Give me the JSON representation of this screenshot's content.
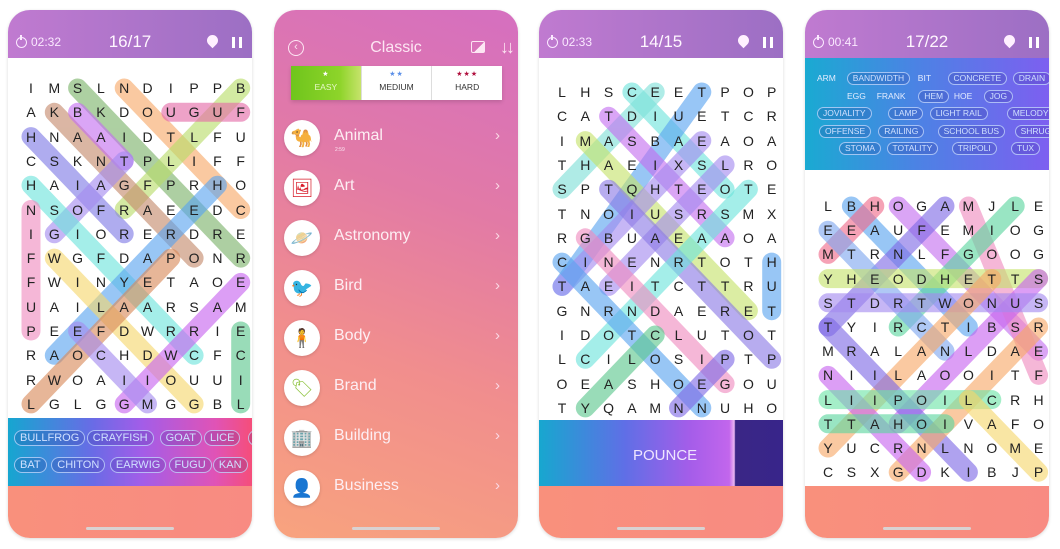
{
  "screens": [
    {
      "type": "puzzle",
      "timer": "02:32",
      "progress": "16/17",
      "grid": [
        "IMSLNDIPPB",
        "AKBKDOUGUF",
        "HNAAIDTLFU",
        "CSKNTPLIFF",
        "HAIAGFPRHO",
        "NSOFRAEEDC",
        "IGIORERDRE",
        "FWGFDAPONR",
        "FWINYETAOE",
        "UAILAARSAM",
        "PEEFDWRRIE",
        "RAOCHDWCFC",
        "RWOAIIOUUI",
        "LGLGGMGGBL"
      ],
      "highlights": [
        {
          "from": [
            0,
            2
          ],
          "to": [
            7,
            9
          ],
          "color": "#7bb36a"
        },
        {
          "from": [
            0,
            4
          ],
          "to": [
            5,
            9
          ],
          "color": "#f7a968"
        },
        {
          "from": [
            0,
            9
          ],
          "to": [
            5,
            4
          ],
          "color": "#b9dd6a"
        },
        {
          "from": [
            1,
            6
          ],
          "to": [
            1,
            9
          ],
          "color": "#e56aa8"
        },
        {
          "from": [
            1,
            1
          ],
          "to": [
            7,
            7
          ],
          "color": "#c58a6c"
        },
        {
          "from": [
            1,
            2
          ],
          "to": [
            3,
            4
          ],
          "color": "#c46ff0"
        },
        {
          "from": [
            2,
            0
          ],
          "to": [
            6,
            4
          ],
          "color": "#7f7ae6"
        },
        {
          "from": [
            3,
            4
          ],
          "to": [
            6,
            1
          ],
          "color": "#a48bf0"
        },
        {
          "from": [
            4,
            0
          ],
          "to": [
            11,
            7
          ],
          "color": "#6ee4dc"
        },
        {
          "from": [
            4,
            8
          ],
          "to": [
            11,
            1
          ],
          "color": "#5aa4f0"
        },
        {
          "from": [
            5,
            0
          ],
          "to": [
            10,
            0
          ],
          "color": "#f08cc0"
        },
        {
          "from": [
            7,
            1
          ],
          "to": [
            13,
            7
          ],
          "color": "#f6d86e"
        },
        {
          "from": [
            7,
            6
          ],
          "to": [
            13,
            0
          ],
          "color": "#d98a5a"
        },
        {
          "from": [
            8,
            9
          ],
          "to": [
            13,
            4
          ],
          "color": "#c864f0"
        },
        {
          "from": [
            10,
            2
          ],
          "to": [
            13,
            5
          ],
          "color": "#a48bf0"
        },
        {
          "from": [
            10,
            9
          ],
          "to": [
            13,
            9
          ],
          "color": "#5cc88e"
        }
      ],
      "words": [
        [
          "BULLFROG",
          "CRAYFISH",
          "GOAT",
          "LICE",
          "O"
        ],
        [
          "BAT",
          "CHITON",
          "EARWIG",
          "FUGU",
          "KAN"
        ]
      ]
    },
    {
      "type": "menu",
      "title": "Classic",
      "difficulties": [
        {
          "stars": "★",
          "label": "EASY",
          "star_color": "#ffffff",
          "active": true
        },
        {
          "stars": "★★",
          "label": "MEDIUM",
          "star_color": "#5b8fe8",
          "active": false
        },
        {
          "stars": "★★★",
          "label": "HARD",
          "star_color": "#b0103e",
          "active": false
        }
      ],
      "categories": [
        {
          "name": "Animal",
          "sub": "2:59",
          "icon": "camel-icon",
          "glyph": "🐪",
          "color": "#e0167d"
        },
        {
          "name": "Art",
          "sub": "",
          "icon": "portrait-icon",
          "glyph": "🖼",
          "color": "#d81b2a"
        },
        {
          "name": "Astronomy",
          "sub": "",
          "icon": "planet-icon",
          "glyph": "🪐",
          "color": "#b0461c"
        },
        {
          "name": "Bird",
          "sub": "",
          "icon": "bird-icon",
          "glyph": "🐦",
          "color": "#f08a1c"
        },
        {
          "name": "Body",
          "sub": "",
          "icon": "body-icon",
          "glyph": "🧍",
          "color": "#f0c01c"
        },
        {
          "name": "Brand",
          "sub": "",
          "icon": "tag-icon",
          "glyph": "🏷",
          "color": "#8cc23c"
        },
        {
          "name": "Building",
          "sub": "",
          "icon": "building-icon",
          "glyph": "🏢",
          "color": "#8cc23c"
        },
        {
          "name": "Business",
          "sub": "",
          "icon": "businessman-icon",
          "glyph": "👤",
          "color": "#1e7a1e"
        }
      ],
      "chevron": "›"
    },
    {
      "type": "puzzle",
      "timer": "02:33",
      "progress": "14/15",
      "grid": [
        "LHSCEETPOP",
        "CATDIUETCR",
        "IMASBAEAOA",
        "THAEIXSLRO",
        "SPTQHTEOTE",
        "TNOIUSRSMX",
        "RGBUAEAAOA",
        "CINENRTOTH",
        "TAEITCTTRU",
        "GNRNDAERET",
        "IDOTCLUTOT",
        "LCILOSIPTP",
        "OEASHOEGOU",
        "TYQAMNNUHO"
      ],
      "highlights": [
        {
          "from": [
            0,
            3
          ],
          "to": [
            4,
            7
          ],
          "color": "#6ee4dc"
        },
        {
          "from": [
            0,
            4
          ],
          "to": [
            4,
            0
          ],
          "color": "#7fe0d8"
        },
        {
          "from": [
            0,
            6
          ],
          "to": [
            8,
            0
          ],
          "color": "#5aa4f0"
        },
        {
          "from": [
            1,
            2
          ],
          "to": [
            6,
            7
          ],
          "color": "#c46ff0"
        },
        {
          "from": [
            2,
            1
          ],
          "to": [
            9,
            8
          ],
          "color": "#c6e36b"
        },
        {
          "from": [
            2,
            6
          ],
          "to": [
            8,
            0
          ],
          "color": "#a48bf0"
        },
        {
          "from": [
            3,
            7
          ],
          "to": [
            8,
            2
          ],
          "color": "#a48bf0"
        },
        {
          "from": [
            4,
            2
          ],
          "to": [
            11,
            9
          ],
          "color": "#8c7ae6"
        },
        {
          "from": [
            4,
            8
          ],
          "to": [
            11,
            1
          ],
          "color": "#6ee4dc"
        },
        {
          "from": [
            6,
            1
          ],
          "to": [
            12,
            7
          ],
          "color": "#f08cc0"
        },
        {
          "from": [
            7,
            0
          ],
          "to": [
            13,
            6
          ],
          "color": "#5aa4f0"
        },
        {
          "from": [
            7,
            9
          ],
          "to": [
            9,
            9
          ],
          "color": "#5aa4f0"
        },
        {
          "from": [
            10,
            4
          ],
          "to": [
            13,
            1
          ],
          "color": "#5cc88e"
        },
        {
          "from": [
            11,
            7
          ],
          "to": [
            13,
            5
          ],
          "color": "#7f6ae6"
        }
      ],
      "ad_label": "POUNCE"
    },
    {
      "type": "puzzle",
      "timer": "00:41",
      "progress": "17/22",
      "word_rows": [
        [
          {
            "w": "ARM",
            "found": false
          },
          {
            "w": "BANDWIDTH",
            "found": true
          },
          {
            "w": "BIT",
            "found": false
          },
          {
            "w": "CONCRETE",
            "found": true
          },
          {
            "w": "DRAIN",
            "found": true
          }
        ],
        [
          {
            "w": "EGG",
            "found": false
          },
          {
            "w": "FRANK",
            "found": false
          },
          {
            "w": "HEM",
            "found": true
          },
          {
            "w": "HOE",
            "found": false
          },
          {
            "w": "JOG",
            "found": true
          }
        ],
        [
          {
            "w": "JOVIALITY",
            "found": true
          },
          {
            "w": "LAMP",
            "found": true
          },
          {
            "w": "LIGHT RAIL",
            "found": true
          },
          {
            "w": "MELODY",
            "found": true
          }
        ],
        [
          {
            "w": "OFFENSE",
            "found": true
          },
          {
            "w": "RAILING",
            "found": true
          },
          {
            "w": "SCHOOL BUS",
            "found": true
          },
          {
            "w": "SHRUG",
            "found": true
          }
        ],
        [
          {
            "w": "STOMA",
            "found": true
          },
          {
            "w": "TOTALITY",
            "found": true
          },
          {
            "w": "TRIPOLI",
            "found": true
          },
          {
            "w": "TUX",
            "found": true
          }
        ]
      ],
      "grid": [
        "LBHOGAMJLE",
        "EEAUFEMIOG",
        "MTRNLFGOOG",
        "YHEODHETTS",
        "STDRTWONUS",
        "TYIRCTIBSR",
        "MRALANLDAE",
        "NIILAOOITF",
        "LIIPOILCRH",
        "TTAHOIVAFO",
        "YUCRNLNOME",
        "CSXGDKIBJP"
      ],
      "highlights": [
        {
          "from": [
            0,
            1
          ],
          "to": [
            5,
            6
          ],
          "color": "#5aa4f0"
        },
        {
          "from": [
            0,
            2
          ],
          "to": [
            2,
            0
          ],
          "color": "#f06a8a"
        },
        {
          "from": [
            0,
            3
          ],
          "to": [
            6,
            9
          ],
          "color": "#c46ff0"
        },
        {
          "from": [
            0,
            5
          ],
          "to": [
            5,
            0
          ],
          "color": "#7f6ae6"
        },
        {
          "from": [
            0,
            6
          ],
          "to": [
            7,
            9
          ],
          "color": "#f08cc0"
        },
        {
          "from": [
            0,
            8
          ],
          "to": [
            5,
            3
          ],
          "color": "#5cd6a0"
        },
        {
          "from": [
            1,
            0
          ],
          "to": [
            6,
            5
          ],
          "color": "#7fa8f0"
        },
        {
          "from": [
            3,
            0
          ],
          "to": [
            3,
            9
          ],
          "color": "#c6e36b"
        },
        {
          "from": [
            3,
            9
          ],
          "to": [
            9,
            3
          ],
          "color": "#c864f0"
        },
        {
          "from": [
            4,
            0
          ],
          "to": [
            4,
            9
          ],
          "color": "#a48bf0"
        },
        {
          "from": [
            3,
            7
          ],
          "to": [
            10,
            0
          ],
          "color": "#f7a968"
        },
        {
          "from": [
            5,
            0
          ],
          "to": [
            11,
            6
          ],
          "color": "#7f6ae6"
        },
        {
          "from": [
            5,
            9
          ],
          "to": [
            11,
            3
          ],
          "color": "#f7a968"
        },
        {
          "from": [
            7,
            0
          ],
          "to": [
            11,
            4
          ],
          "color": "#c864f0"
        },
        {
          "from": [
            8,
            0
          ],
          "to": [
            8,
            7
          ],
          "color": "#6ee4a8"
        },
        {
          "from": [
            8,
            6
          ],
          "to": [
            11,
            9
          ],
          "color": "#f6d86e"
        },
        {
          "from": [
            9,
            0
          ],
          "to": [
            9,
            5
          ],
          "color": "#5cd6a0"
        }
      ]
    }
  ]
}
